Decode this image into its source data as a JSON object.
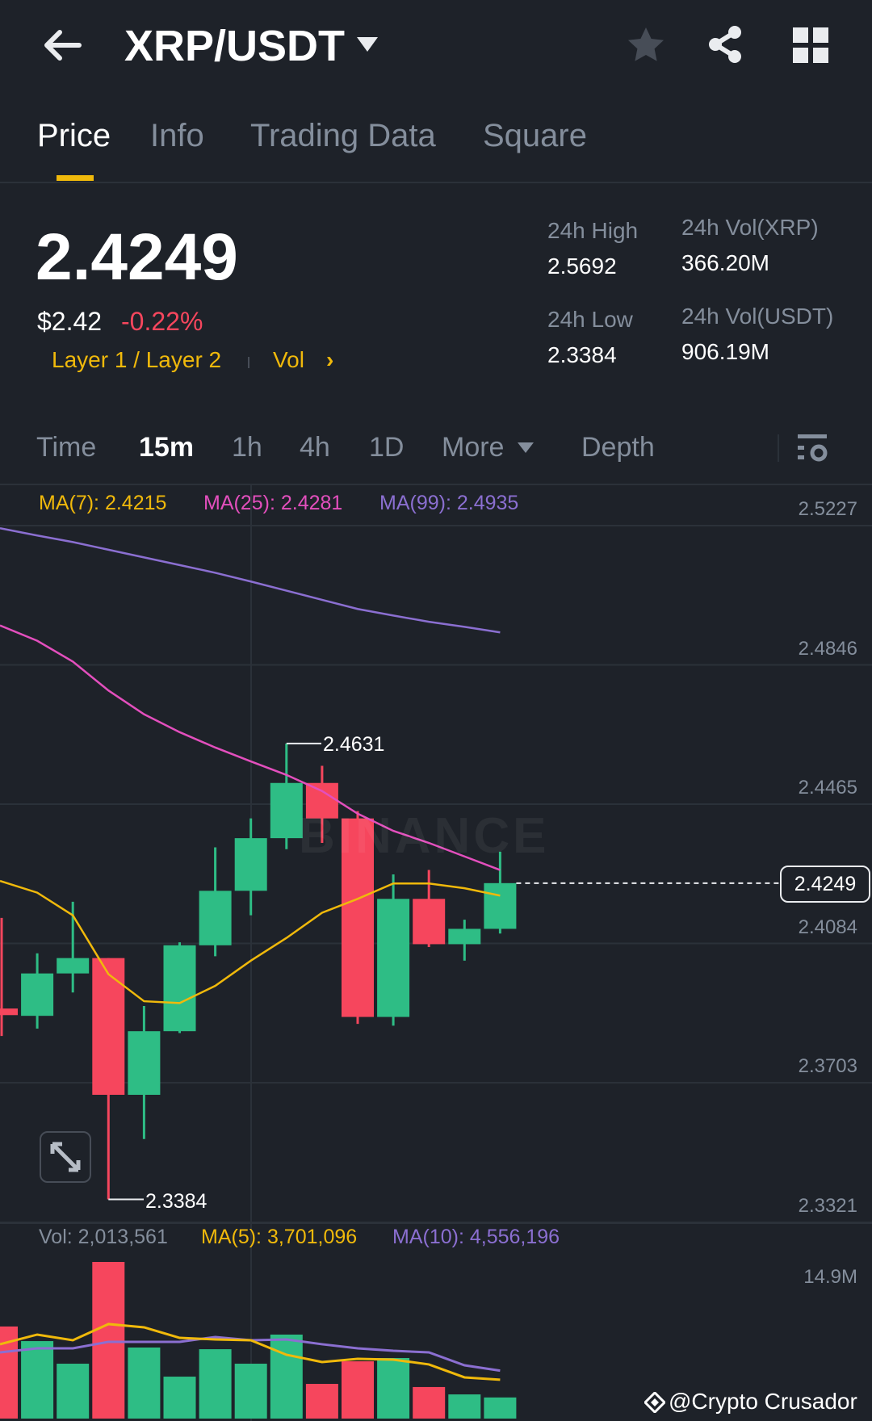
{
  "header": {
    "title": "XRP/USDT",
    "icons": [
      "back-arrow-icon",
      "caret-down-icon",
      "star-icon",
      "share-icon",
      "grid-icon"
    ]
  },
  "tabs": [
    {
      "label": "Price",
      "active": true
    },
    {
      "label": "Info"
    },
    {
      "label": "Trading Data"
    },
    {
      "label": "Square"
    }
  ],
  "ticker": {
    "last": "2.4249",
    "usd": "$2.42",
    "change": "-0.22%",
    "tag": "Layer 1 / Layer 2",
    "vol_link": "Vol",
    "chevron": "›",
    "high_label": "24h High",
    "high": "2.5692",
    "low_label": "24h Low",
    "low": "2.3384",
    "volx_label": "24h Vol(XRP)",
    "volx": "366.20M",
    "volu_label": "24h Vol(USDT)",
    "volu": "906.19M"
  },
  "timeframes": {
    "time": "Time",
    "items": [
      "15m",
      "1h",
      "4h",
      "1D"
    ],
    "active": "15m",
    "more": "More",
    "depth": "Depth"
  },
  "legend": {
    "ma7": "MA(7): 2.4215",
    "ma25": "MA(25): 2.4281",
    "ma99": "MA(99): 2.4935"
  },
  "vol_legend": {
    "vol": "Vol: 2,013,561",
    "ma5": "MA(5): 3,701,096",
    "ma10": "MA(10): 4,556,196",
    "max": "14.9M"
  },
  "watermark": "@Crypto Crusador",
  "logo_text": "BINANCE",
  "colors": {
    "up": "#2ebd85",
    "down": "#f6465d",
    "ma7": "#f0b90b",
    "ma25": "#e34fbd",
    "ma99": "#8b6fd1",
    "accent": "#f0b90b"
  },
  "chart_data": {
    "type": "candlestick",
    "interval": "15m",
    "y_ticks": [
      "2.5227",
      "2.4846",
      "2.4465",
      "2.4084",
      "2.3703",
      "2.3321"
    ],
    "ylim": [
      2.3321,
      2.5227
    ],
    "last_price": "2.4249",
    "high_mark": "2.4631",
    "low_mark": "2.3384",
    "candles": [
      {
        "o": 2.3906,
        "h": 2.4154,
        "l": 2.3831,
        "c": 2.3888
      },
      {
        "o": 2.3886,
        "h": 2.4057,
        "l": 2.3851,
        "c": 2.4002
      },
      {
        "o": 2.4002,
        "h": 2.4198,
        "l": 2.395,
        "c": 2.4044
      },
      {
        "o": 2.4044,
        "h": 2.4044,
        "l": 2.3384,
        "c": 2.367
      },
      {
        "o": 2.367,
        "h": 2.3913,
        "l": 2.3549,
        "c": 2.3844
      },
      {
        "o": 2.3844,
        "h": 2.4087,
        "l": 2.3839,
        "c": 2.4079
      },
      {
        "o": 2.4079,
        "h": 2.4347,
        "l": 2.4049,
        "c": 2.4228
      },
      {
        "o": 2.4228,
        "h": 2.4426,
        "l": 2.4161,
        "c": 2.4372
      },
      {
        "o": 2.4372,
        "h": 2.4631,
        "l": 2.4342,
        "c": 2.4523
      },
      {
        "o": 2.4523,
        "h": 2.457,
        "l": 2.4359,
        "c": 2.4426
      },
      {
        "o": 2.4426,
        "h": 2.4446,
        "l": 2.3864,
        "c": 2.3883
      },
      {
        "o": 2.3883,
        "h": 2.4273,
        "l": 2.3859,
        "c": 2.4206
      },
      {
        "o": 2.4206,
        "h": 2.4285,
        "l": 2.4074,
        "c": 2.4082
      },
      {
        "o": 2.4082,
        "h": 2.4149,
        "l": 2.4037,
        "c": 2.4124
      },
      {
        "o": 2.4124,
        "h": 2.4335,
        "l": 2.4111,
        "c": 2.4249
      }
    ],
    "ma7": [
      2.4255,
      2.4223,
      2.4161,
      2.4,
      2.3926,
      2.3921,
      2.3968,
      2.4037,
      2.4099,
      2.4168,
      2.4206,
      2.4248,
      2.4248,
      2.4235,
      2.4215
    ],
    "ma25": [
      2.4954,
      2.4912,
      2.4855,
      2.4776,
      2.4711,
      2.4662,
      2.462,
      2.4582,
      2.4545,
      2.4501,
      2.4439,
      2.4392,
      2.4359,
      2.4322,
      2.4285
    ],
    "ma99": [
      2.522,
      2.52,
      2.5182,
      2.5161,
      2.514,
      2.5119,
      2.5098,
      2.5074,
      2.5049,
      2.5024,
      2.4999,
      2.4981,
      2.4964,
      2.495,
      2.4935
    ],
    "volume_millions": [
      8.76,
      7.37,
      5.22,
      14.9,
      6.76,
      3.99,
      6.6,
      5.22,
      7.99,
      3.3,
      5.45,
      5.76,
      3.0,
      2.3,
      2.01
    ],
    "vol_ma5_millions": [
      7.07,
      7.99,
      7.45,
      8.99,
      8.68,
      7.68,
      7.53,
      7.45,
      6.07,
      5.38,
      5.68,
      5.61,
      5.15,
      3.92,
      3.7
    ],
    "vol_ma10_millions": [
      6.3,
      6.68,
      6.68,
      7.3,
      7.3,
      7.3,
      7.76,
      7.45,
      7.53,
      7.07,
      6.68,
      6.45,
      6.3,
      5.07,
      4.56
    ]
  }
}
